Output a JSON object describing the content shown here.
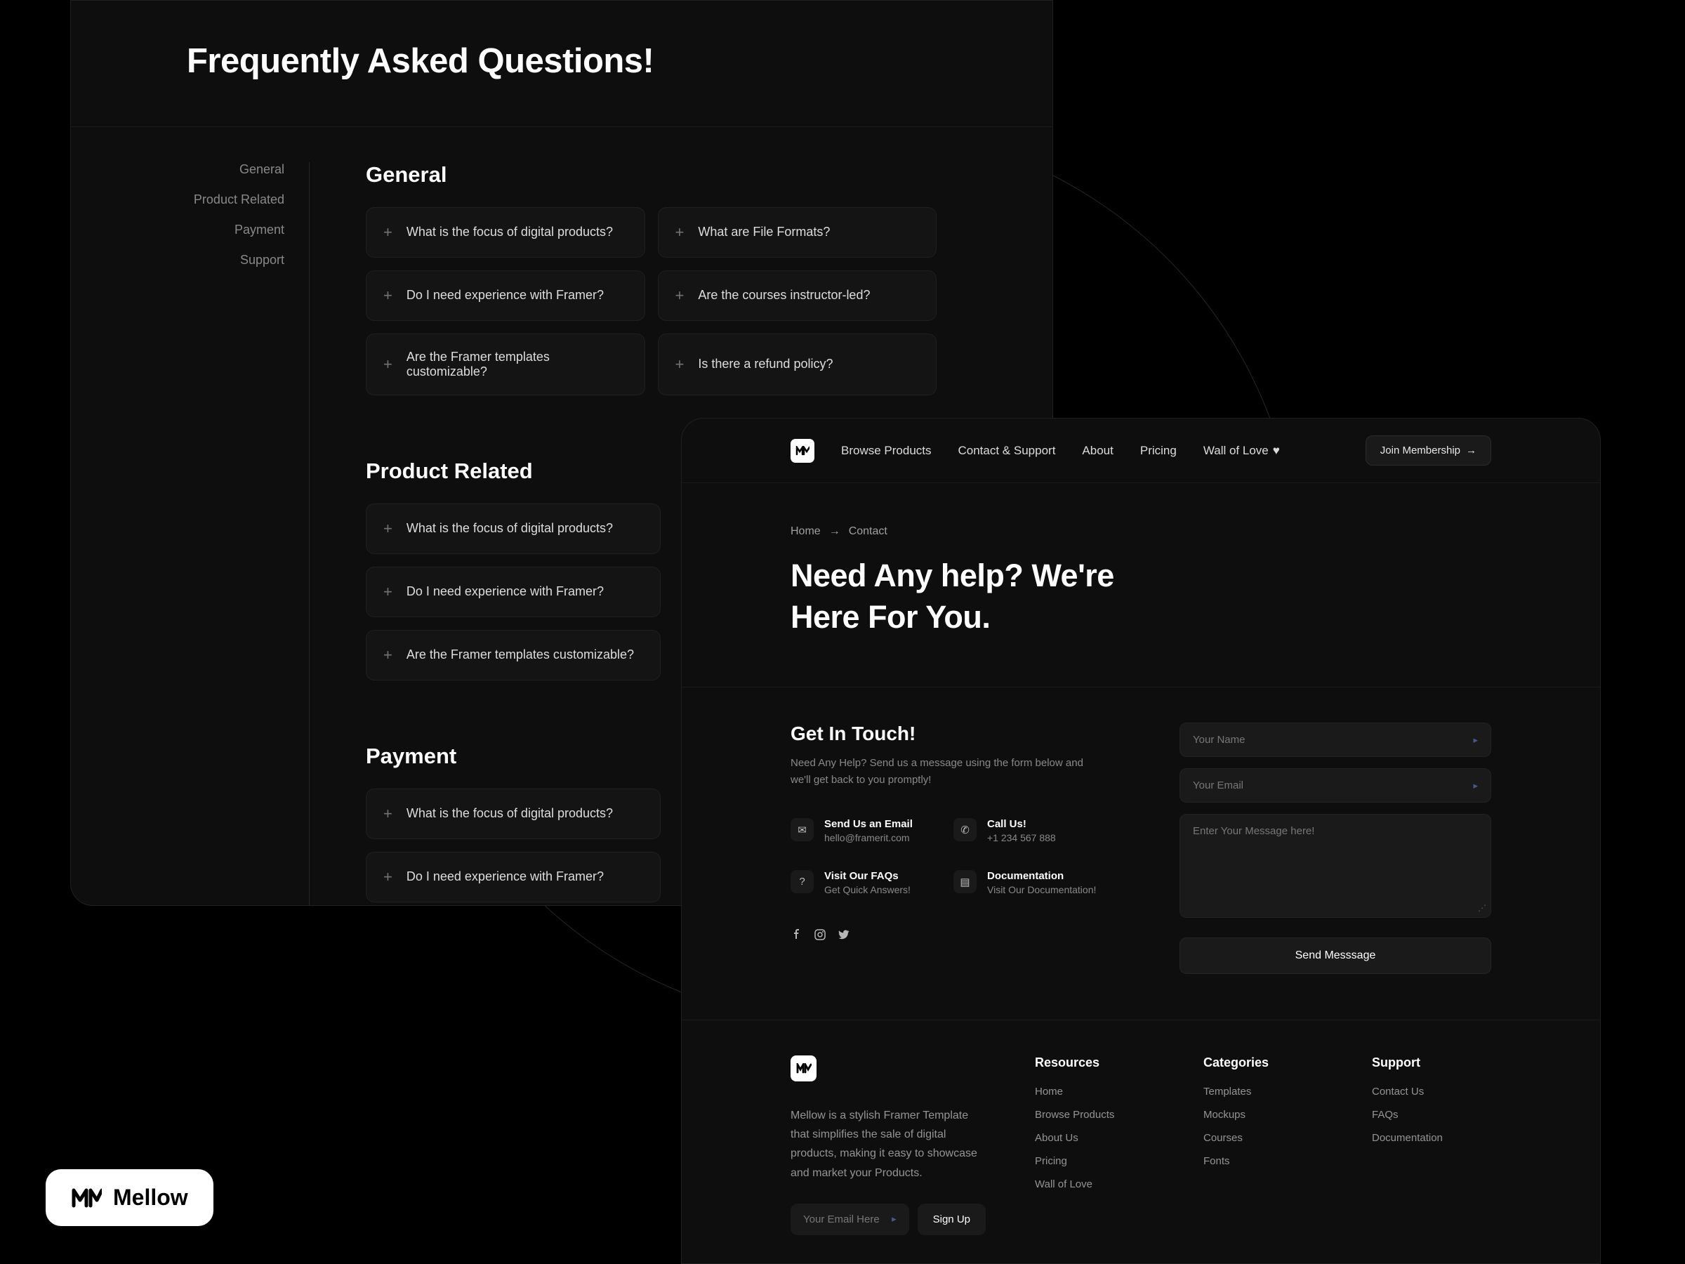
{
  "faq": {
    "title": "Frequently Asked Questions!",
    "sidebar": [
      "General",
      "Product Related",
      "Payment",
      "Support"
    ],
    "sections": [
      {
        "title": "General",
        "items_col1": [
          "What is the focus of digital products?",
          "Do I need experience with Framer?",
          "Are the Framer templates customizable?"
        ],
        "items_col2": [
          "What are File Formats?",
          "Are the courses instructor-led?",
          "Is there a refund policy?"
        ]
      },
      {
        "title": "Product Related",
        "items": [
          "What is the focus of digital products?",
          "Do I need experience with Framer?",
          "Are the Framer templates customizable?"
        ]
      },
      {
        "title": "Payment",
        "items": [
          "What is the focus of digital products?",
          "Do I need experience with Framer?"
        ]
      }
    ]
  },
  "contact": {
    "nav": {
      "items": [
        "Browse Products",
        "Contact & Support",
        "About",
        "Pricing",
        "Wall of Love"
      ],
      "join": "Join Membership"
    },
    "breadcrumb": {
      "home": "Home",
      "current": "Contact"
    },
    "hero_title": "Need Any help? We're Here For You.",
    "form": {
      "title": "Get In Touch!",
      "desc": "Need Any Help? Send us a message using the form below and we'll get back to you promptly!",
      "name_ph": "Your Name",
      "email_ph": "Your Email",
      "msg_ph": "Enter Your Message here!",
      "send": "Send Messsage"
    },
    "contacts": [
      {
        "title": "Send Us an Email",
        "sub": "hello@framerit.com"
      },
      {
        "title": "Call Us!",
        "sub": "+1 234 567 888"
      },
      {
        "title": "Visit Our FAQs",
        "sub": "Get Quick Answers!"
      },
      {
        "title": "Documentation",
        "sub": "Visit Our Documentation!"
      }
    ]
  },
  "footer": {
    "desc": "Mellow is a stylish Framer Template that simplifies the sale of digital products, making it easy to showcase and market your Products.",
    "email_ph": "Your Email Here",
    "signup": "Sign Up",
    "cols": [
      {
        "title": "Resources",
        "links": [
          "Home",
          "Browse Products",
          "About Us",
          "Pricing",
          "Wall of Love"
        ]
      },
      {
        "title": "Categories",
        "links": [
          "Templates",
          "Mockups",
          "Courses",
          "Fonts"
        ]
      },
      {
        "title": "Support",
        "links": [
          "Contact Us",
          "FAQs",
          "Documentation"
        ]
      }
    ]
  },
  "badge": {
    "text": "Mellow"
  }
}
